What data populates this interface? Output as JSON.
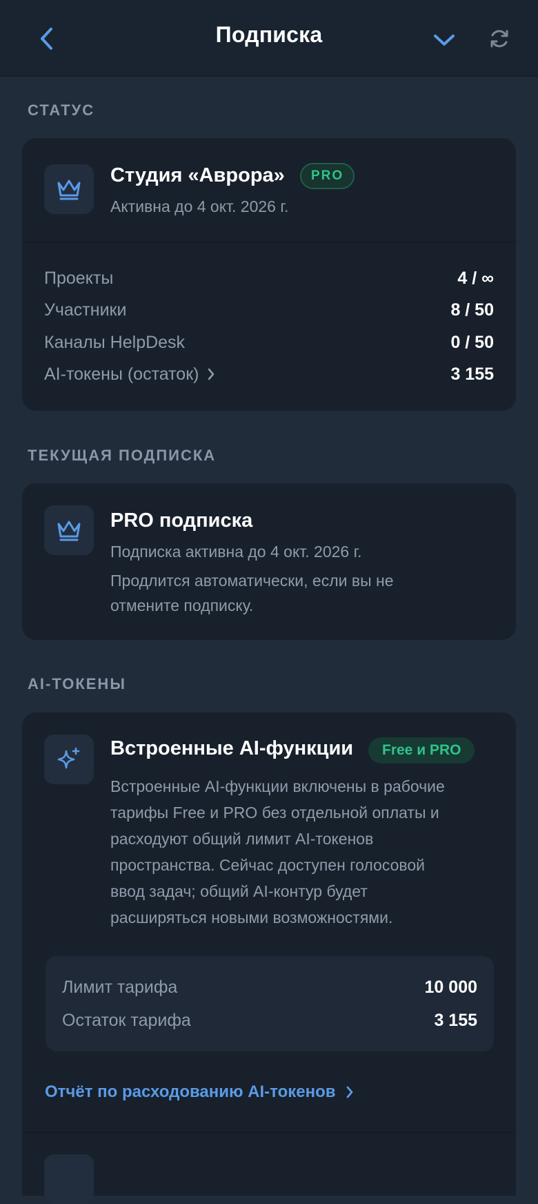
{
  "header": {
    "title": "Подписка"
  },
  "status_section": {
    "heading": "СТАТУС",
    "org_name": "Студия «Аврора»",
    "badge": "PRO",
    "active_until": "Активна до 4 окт. 2026 г.",
    "stats": [
      {
        "label": "Проекты",
        "value": "4 / ∞"
      },
      {
        "label": "Участники",
        "value": "8 / 50"
      },
      {
        "label": "Каналы HelpDesk",
        "value": "0 / 50"
      },
      {
        "label": "AI-токены (остаток)",
        "value": "3 155"
      }
    ]
  },
  "current_section": {
    "heading": "ТЕКУЩАЯ ПОДПИСКА",
    "plan_title": "PRO подписка",
    "active_line": "Подписка активна до 4 окт. 2026 г.",
    "renew_line1": "Продлится автоматически, если вы не",
    "renew_line2": "отмените подписку."
  },
  "ai_section": {
    "heading": "AI-ТОКЕНЫ",
    "feature_title": "Встроенные AI-функции",
    "feature_badge": "Free и PRO",
    "description_lines": [
      "Встроенные AI-функции включены в рабочие",
      "тарифы Free и PRO без отдельной оплаты и",
      "расходуют общий лимит AI-токенов",
      "пространства. Сейчас доступен голосовой",
      "ввод задач; общий AI-контур будет",
      "расширяться новыми возможностями."
    ],
    "limits": [
      {
        "label": "Лимит тарифа",
        "value": "10 000"
      },
      {
        "label": "Остаток тарифа",
        "value": "3 155"
      }
    ],
    "report_link": "Отчёт по расходованию AI-токенов"
  },
  "colors": {
    "background": "#212c3b",
    "card": "#18202b",
    "accent_blue": "#5a9be6",
    "accent_green": "#2fc38a"
  },
  "icons": [
    "chevron-left-icon",
    "chevron-down-icon",
    "refresh-icon",
    "crown-icon",
    "sparkles-icon",
    "chevron-right-icon"
  ]
}
